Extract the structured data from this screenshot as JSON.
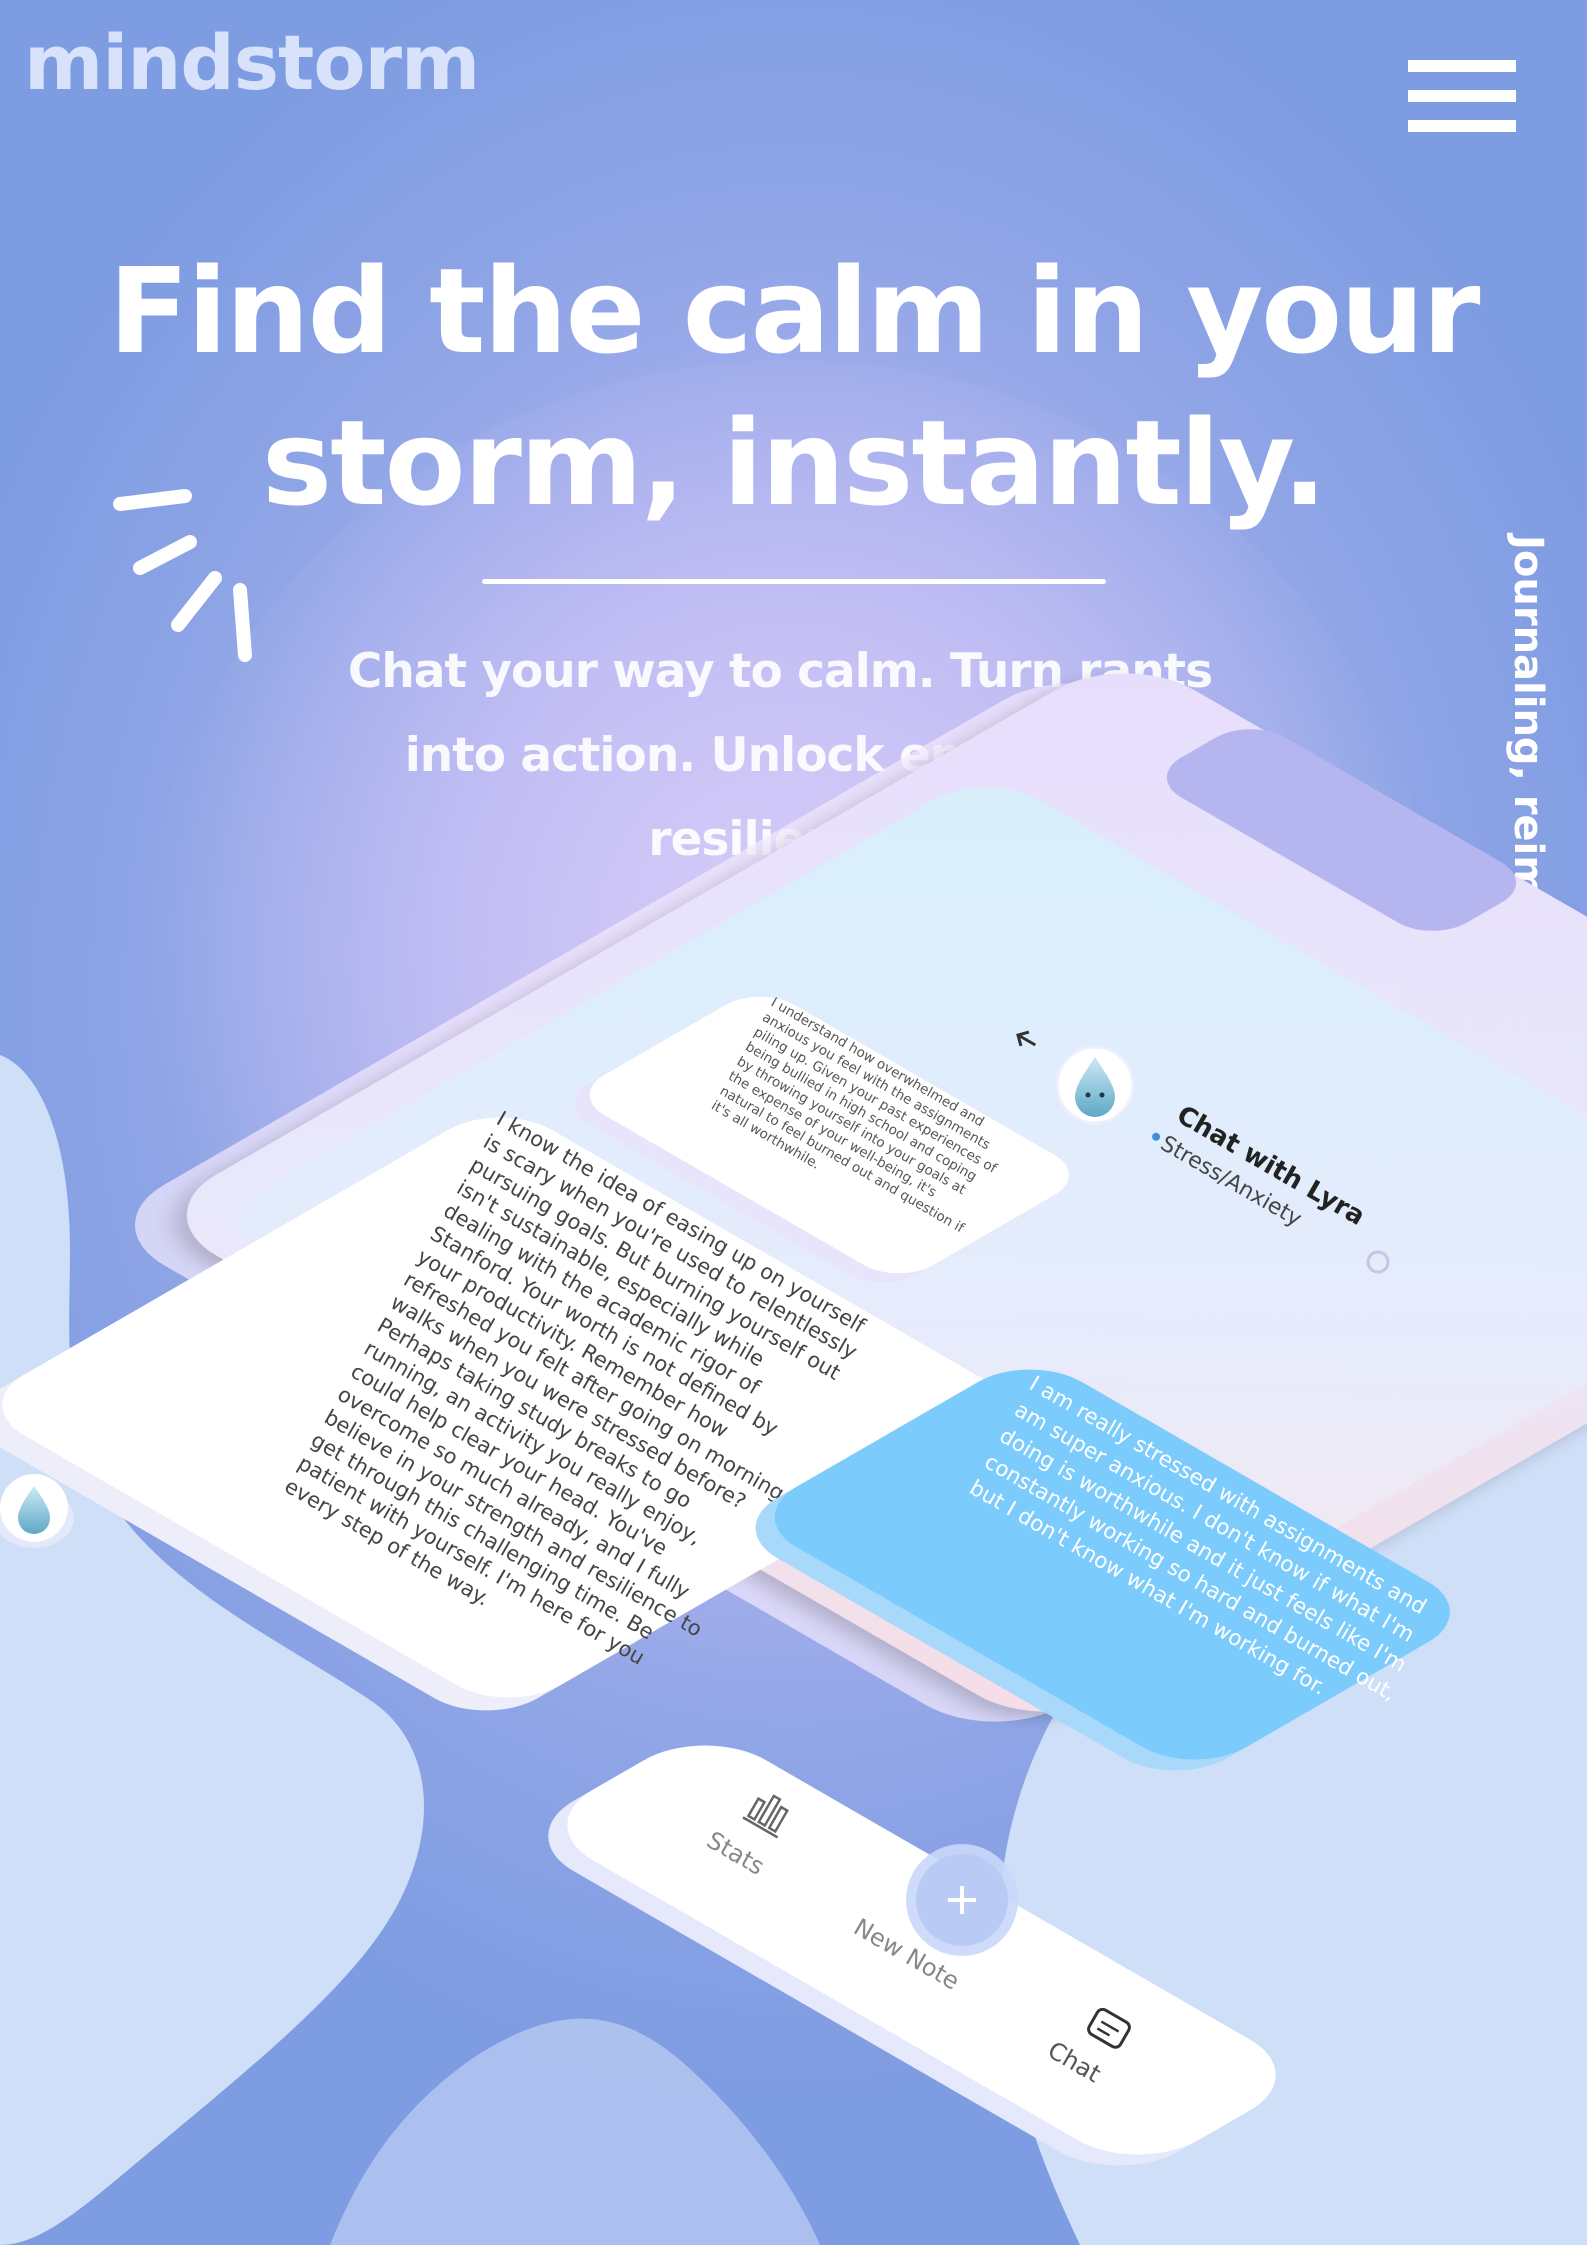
{
  "brand": {
    "logo": "mindstorm"
  },
  "hero": {
    "title_line1": "Find the calm in your",
    "title_line2": "storm, instantly.",
    "subtitle_line1": "Chat your way to calm. Turn rants",
    "subtitle_line2": "into action. Unlock emotional",
    "subtitle_line3": "resilience.",
    "vertical_tagline": "Journaling, reimagined."
  },
  "phone": {
    "chat_title": "Chat with Lyra",
    "chat_topic": "Stress/Anxiety",
    "assistant_message_small": [
      "I understand how overwhelmed and",
      "anxious you feel with the assignments",
      "piling up. Given your past experiences of",
      "being bullied in high school and coping",
      "by throwing yourself into your goals at",
      "the expense of your well-being, it's",
      "natural to feel burned out and question if",
      "it's all worthwhile."
    ],
    "assistant_message_large": [
      "I know the idea of easing up on yourself",
      "is scary when you're used to relentlessly",
      "pursuing goals. But burning yourself out",
      "isn't sustainable, especially while",
      "dealing with the academic rigor of",
      "Stanford. Your worth is not defined by",
      "your productivity. Remember how",
      "refreshed you felt after going on morning",
      "walks when you were stressed before?",
      "Perhaps taking study breaks to go",
      "running, an activity you really enjoy,",
      "could help clear your head. You've",
      "overcome so much already, and I fully",
      "believe in your strength and resilience to",
      "get through this challenging time. Be",
      "patient with yourself. I'm here for you",
      "every step of the way."
    ],
    "user_message": [
      "I am really stressed with assignments and",
      "am super anxious. I don't know if what I'm",
      "doing is worthwhile and it just feels like I'm",
      "constantly working so hard and burned out,",
      "but I don't know what I'm working for."
    ],
    "nav": {
      "stats": "Stats",
      "new_note": "New Note",
      "chat": "Chat",
      "add_symbol": "+"
    }
  },
  "colors": {
    "user_bubble": "#7ccbfd",
    "accent_blue": "#3d8fe0",
    "background": "#8fa5e6"
  },
  "icons": [
    "menu-icon",
    "back-arrow-icon",
    "lyra-droplet-icon",
    "stats-icon",
    "plus-icon",
    "chat-icon",
    "share-icon"
  ]
}
